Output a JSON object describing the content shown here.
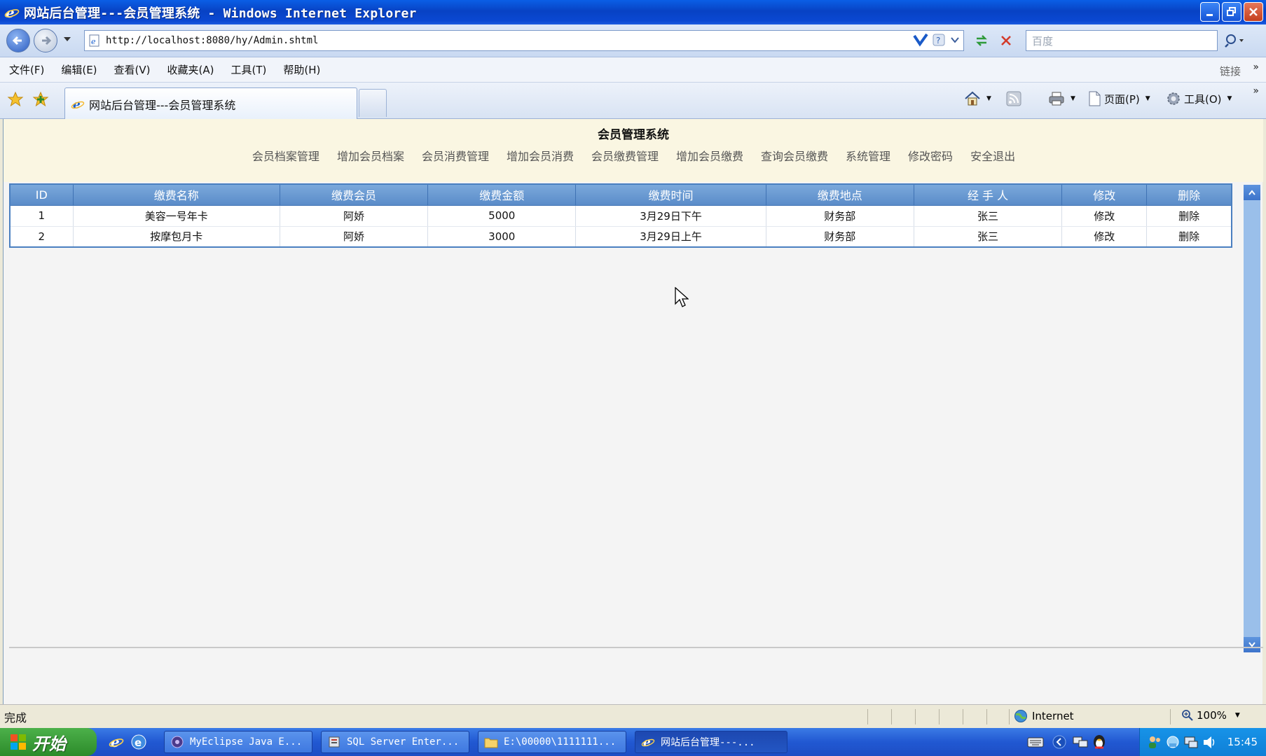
{
  "window": {
    "title": "网站后台管理---会员管理系统 - Windows Internet Explorer"
  },
  "address": {
    "url": "http://localhost:8080/hy/Admin.shtml",
    "search_placeholder": "百度"
  },
  "menu": {
    "items": [
      "文件(F)",
      "编辑(E)",
      "查看(V)",
      "收藏夹(A)",
      "工具(T)",
      "帮助(H)"
    ],
    "links": "链接"
  },
  "tabs": {
    "active_title": "网站后台管理---会员管理系统"
  },
  "commands": {
    "page": "页面(P)",
    "tools": "工具(O)"
  },
  "page": {
    "title": "会员管理系统",
    "nav": [
      "会员档案管理",
      "增加会员档案",
      "会员消费管理",
      "增加会员消费",
      "会员缴费管理",
      "增加会员缴费",
      "查询会员缴费",
      "系统管理",
      "修改密码",
      "安全退出"
    ],
    "table": {
      "headers": [
        "ID",
        "缴费名称",
        "缴费会员",
        "缴费金额",
        "缴费时间",
        "缴费地点",
        "经 手 人",
        "修改",
        "删除"
      ],
      "rows": [
        [
          "1",
          "美容一号年卡",
          "阿娇",
          "5000",
          "3月29日下午",
          "财务部",
          "张三",
          "修改",
          "删除"
        ],
        [
          "2",
          "按摩包月卡",
          "阿娇",
          "3000",
          "3月29日上午",
          "财务部",
          "张三",
          "修改",
          "删除"
        ]
      ]
    }
  },
  "status": {
    "text": "完成",
    "zone": "Internet",
    "zoom": "100%"
  },
  "taskbar": {
    "start": "开始",
    "tasks": [
      "MyEclipse Java E...",
      "SQL Server Enter...",
      "E:\\00000\\1111111...",
      "网站后台管理---..."
    ],
    "clock": "15:45"
  },
  "colors": {
    "titlebar": "#0A48D2",
    "table_header": "#5A8CC9",
    "page_header_band": "#FAF6E2",
    "taskbar": "#2158D2",
    "start_button": "#3C9E3A"
  }
}
